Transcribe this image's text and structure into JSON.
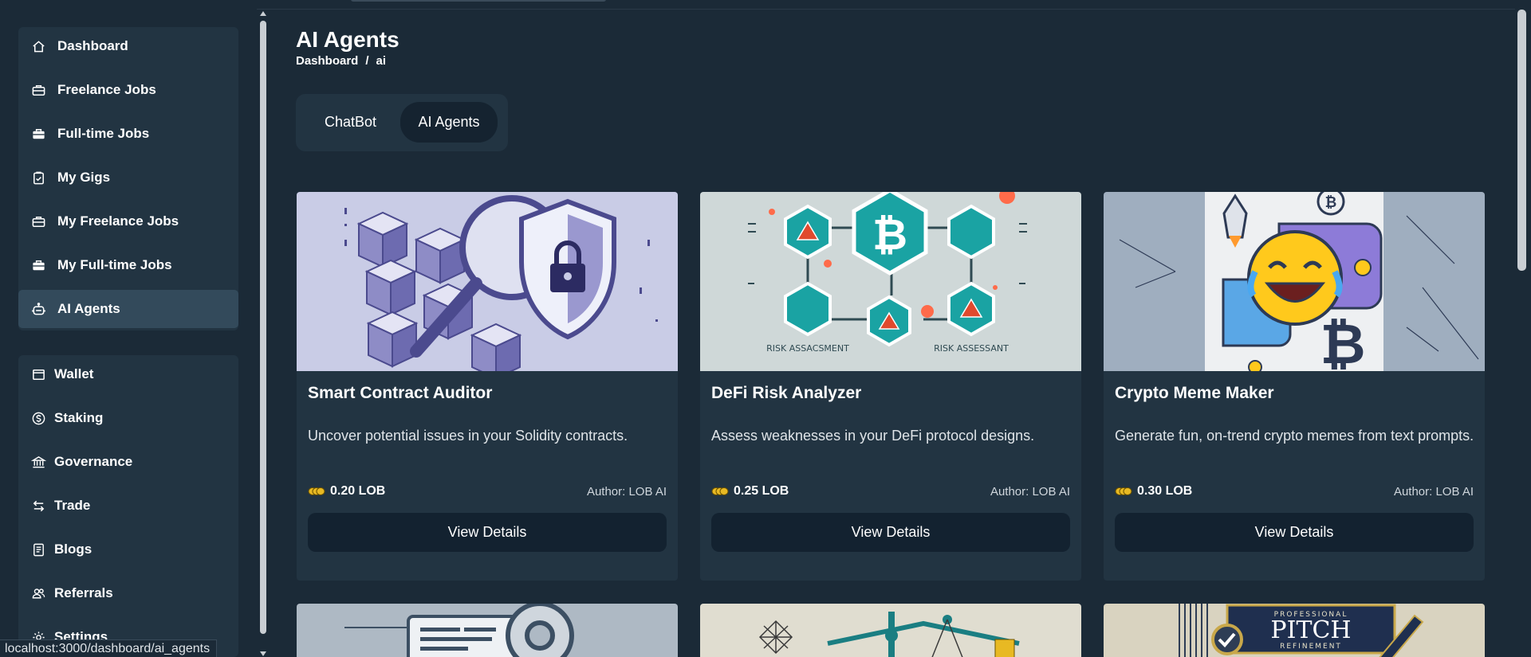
{
  "sidebar": {
    "group_jobs": [
      {
        "label": "Dashboard",
        "icon": "home-icon"
      },
      {
        "label": "Freelance Jobs",
        "icon": "briefcase-icon"
      },
      {
        "label": "Full-time Jobs",
        "icon": "briefcase-filled-icon"
      },
      {
        "label": "My Gigs",
        "icon": "clipboard-check-icon"
      },
      {
        "label": "My Freelance Jobs",
        "icon": "briefcase-icon"
      },
      {
        "label": "My Full-time Jobs",
        "icon": "briefcase-filled-icon"
      },
      {
        "label": "AI Agents",
        "icon": "robot-icon",
        "active": true
      }
    ],
    "group_misc": [
      {
        "label": "Wallet",
        "icon": "wallet-icon"
      },
      {
        "label": "Staking",
        "icon": "dollar-coin-icon"
      },
      {
        "label": "Governance",
        "icon": "bank-icon"
      },
      {
        "label": "Trade",
        "icon": "swap-arrows-icon"
      },
      {
        "label": "Blogs",
        "icon": "document-icon"
      },
      {
        "label": "Referrals",
        "icon": "users-icon"
      },
      {
        "label": "Settings",
        "icon": "gear-icon"
      }
    ]
  },
  "header": {
    "title": "AI Agents",
    "breadcrumb": [
      "Dashboard",
      "/",
      "ai"
    ]
  },
  "tabs": [
    {
      "label": "ChatBot",
      "active": false
    },
    {
      "label": "AI Agents",
      "active": true
    }
  ],
  "agents": [
    {
      "title": "Smart Contract Auditor",
      "description": "Uncover potential issues in your Solidity contracts.",
      "price": "0.20 LOB",
      "author": "Author: LOB AI",
      "button": "View Details",
      "image": "smart-contract-shield-illustration"
    },
    {
      "title": "DeFi Risk Analyzer",
      "description": "Assess weaknesses in your DeFi protocol designs.",
      "price": "0.25 LOB",
      "author": "Author: LOB AI",
      "button": "View Details",
      "image": "bitcoin-risk-network-illustration",
      "image_text": [
        "RISK ASSACSMENT",
        "RISK ASSESSANT"
      ]
    },
    {
      "title": "Crypto Meme Maker",
      "description": "Generate fun, on-trend crypto memes from text prompts.",
      "price": "0.30 LOB",
      "author": "Author: LOB AI",
      "button": "View Details",
      "image": "laughing-emoji-crypto-illustration"
    }
  ],
  "partial_cards": [
    {
      "image": "code-gear-illustration"
    },
    {
      "image": "network-scale-illustration"
    },
    {
      "image": "pitch-refinement-illustration",
      "image_text": [
        "PROFESSIONAL",
        "PITCH",
        "REFINEMENT"
      ]
    }
  ],
  "status_bar": {
    "url": "localhost:3000/dashboard/ai_agents"
  },
  "colors": {
    "background": "#1b2a37",
    "panel": "#223442",
    "active_item": "#334a5b",
    "button": "#132230",
    "accent_teal": "#1aa3a3"
  }
}
